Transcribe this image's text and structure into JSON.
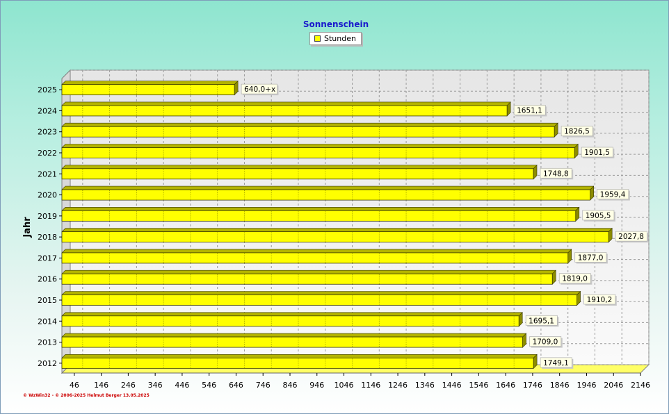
{
  "chart_data": {
    "type": "bar",
    "orientation": "horizontal",
    "title": "Sonnenschein",
    "ylabel": "Jahr",
    "xlabel": "",
    "categories": [
      "2012",
      "2013",
      "2014",
      "2015",
      "2016",
      "2017",
      "2018",
      "2019",
      "2020",
      "2021",
      "2022",
      "2023",
      "2024",
      "2025"
    ],
    "series": [
      {
        "name": "Stunden",
        "color": "#ffff00",
        "values": [
          1749.1,
          1709.0,
          1695.1,
          1910.2,
          1819.0,
          1877.0,
          2027.8,
          1905.5,
          1959.4,
          1748.8,
          1901.5,
          1826.5,
          1651.1,
          640.0
        ],
        "labels": [
          "1749,1",
          "1709,0",
          "1695,1",
          "1910,2",
          "1819,0",
          "1877,0",
          "2027,8",
          "1905,5",
          "1959,4",
          "1748,8",
          "1901,5",
          "1826,5",
          "1651,1",
          "640,0+x"
        ]
      }
    ],
    "xlim": [
      0,
      2146
    ],
    "xticks": [
      46,
      146,
      246,
      346,
      446,
      546,
      646,
      746,
      846,
      946,
      1046,
      1146,
      1246,
      1346,
      1446,
      1546,
      1646,
      1746,
      1846,
      1946,
      2046,
      2146
    ],
    "grid": true,
    "legend_position": "top-center"
  },
  "copyright": "© WzWin32 - © 2006-2025 Helmut Berger  13.05.2025"
}
